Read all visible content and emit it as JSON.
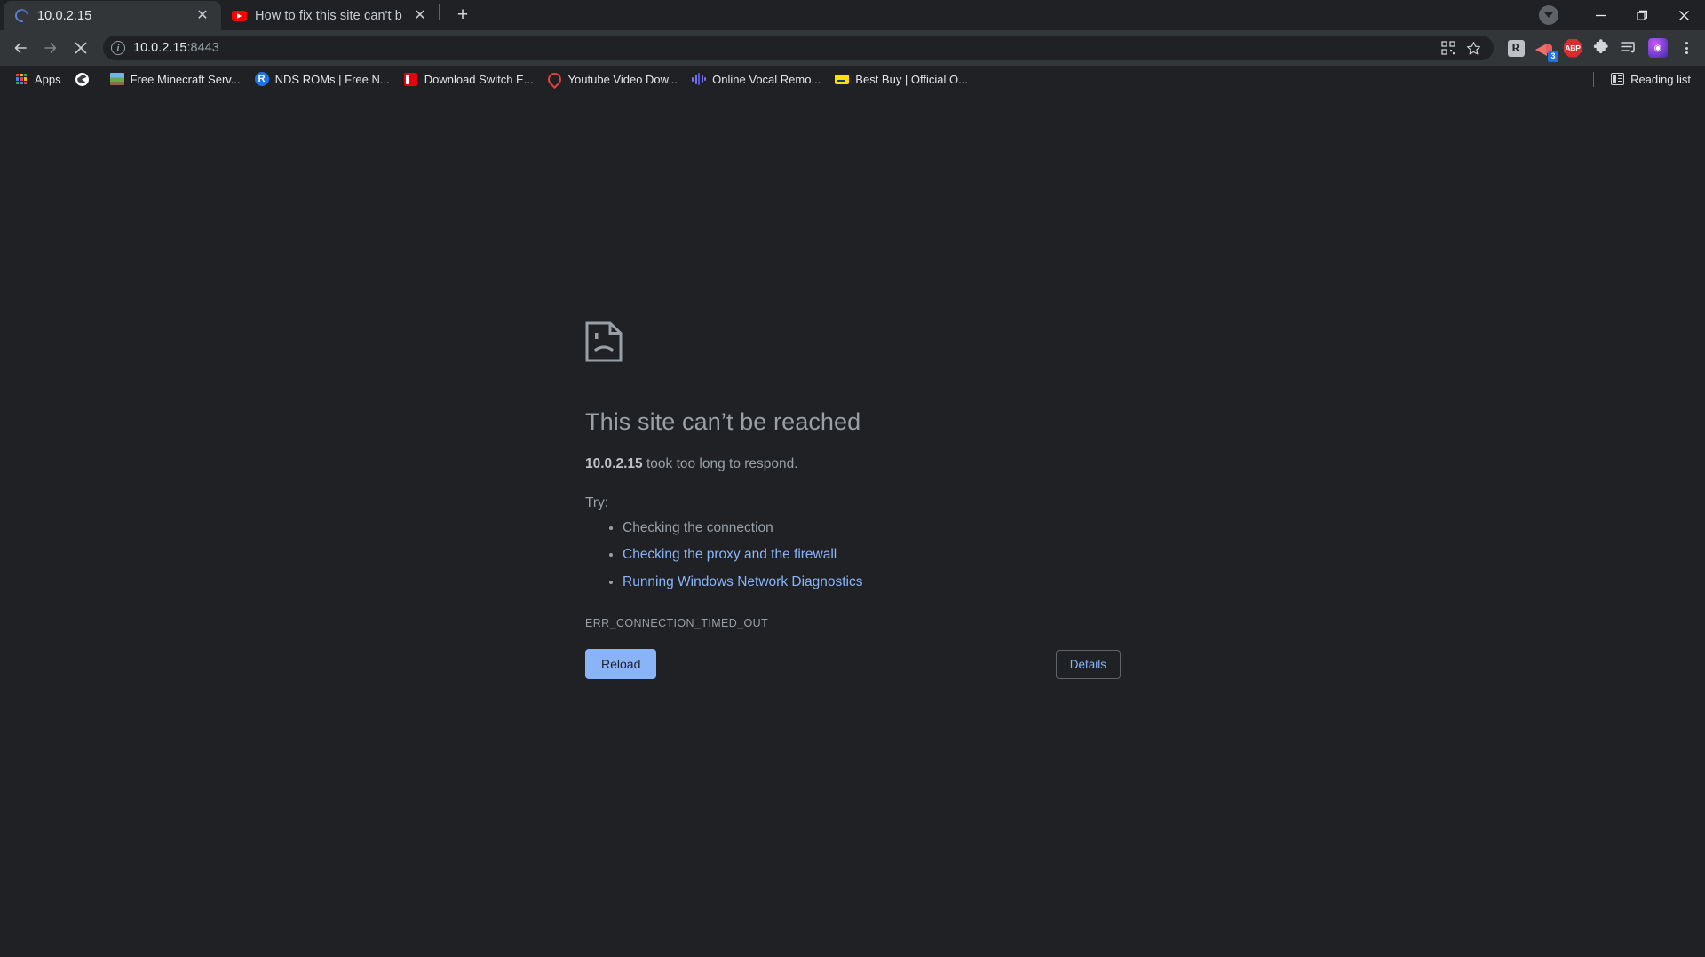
{
  "window": {
    "controls": {
      "download_label": "downloads",
      "minimize_label": "Minimize",
      "maximize_label": "Restore",
      "close_label": "Close"
    }
  },
  "tabs": [
    {
      "title": "10.0.2.15",
      "favicon": "loading-spinner-icon",
      "active": true,
      "close_label": "✕"
    },
    {
      "title": "How to fix this site can't be reach",
      "favicon": "youtube-icon",
      "active": false,
      "close_label": "✕"
    }
  ],
  "newtab_label": "+",
  "toolbar": {
    "back_label": "Back",
    "forward_label": "Forward",
    "stop_label": "Stop",
    "url_host": "10.0.2.15",
    "url_port": ":8443",
    "url_full": "10.0.2.15:8443",
    "info_glyph": "i",
    "qr_label": "Create QR code",
    "bookmark_label": "Bookmark this tab",
    "extensions": [
      {
        "name": "r-extension-icon",
        "label": "R"
      },
      {
        "name": "megaphone-extension-icon",
        "badge": "3"
      },
      {
        "name": "adblock-plus-icon",
        "label": "ABP"
      },
      {
        "name": "puzzle-extensions-icon"
      },
      {
        "name": "music-playlist-icon"
      },
      {
        "name": "profile-avatar-icon"
      }
    ],
    "menu_label": "Customize and control Google Chrome"
  },
  "bookmarks": {
    "items": [
      {
        "label": "Apps",
        "icon": "apps-grid-icon"
      },
      {
        "label": "",
        "icon": "globe-icon"
      },
      {
        "label": "Free Minecraft Serv...",
        "icon": "minecraft-icon"
      },
      {
        "label": "NDS ROMs | Free N...",
        "icon": "r-circle-icon"
      },
      {
        "label": "Download Switch E...",
        "icon": "switch-icon"
      },
      {
        "label": "Youtube Video Dow...",
        "icon": "location-pin-icon"
      },
      {
        "label": "Online Vocal Remo...",
        "icon": "waveform-icon"
      },
      {
        "label": "Best Buy | Official O...",
        "icon": "bestbuy-tag-icon"
      }
    ],
    "reading_list_label": "Reading list",
    "reading_list_icon": "reading-list-icon"
  },
  "error_page": {
    "icon": "sad-document-icon",
    "title": "This site can’t be reached",
    "subject": "10.0.2.15",
    "subject_suffix": " took too long to respond.",
    "try_label": "Try:",
    "suggestions": [
      {
        "text": "Checking the connection",
        "link": false
      },
      {
        "text": "Checking the proxy and the firewall",
        "link": true
      },
      {
        "text": "Running Windows Network Diagnostics",
        "link": true
      }
    ],
    "error_code": "ERR_CONNECTION_TIMED_OUT",
    "reload_button": "Reload",
    "details_button": "Details"
  },
  "colors": {
    "page_bg": "#202124",
    "toolbar_bg": "#323639",
    "accent_blue": "#8ab4f8",
    "text_muted": "#9aa0a6",
    "link_blue": "#8ab4f8"
  }
}
